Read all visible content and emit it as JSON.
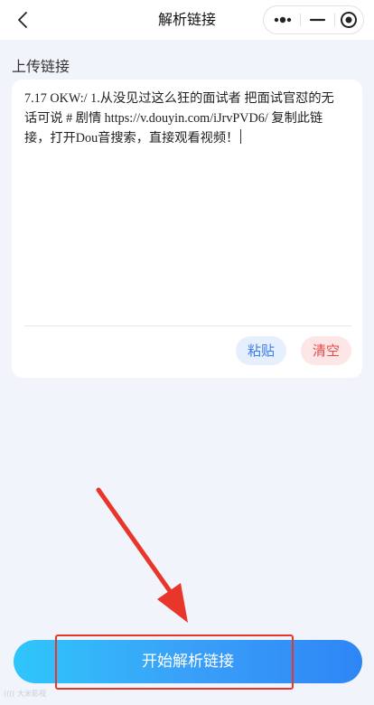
{
  "navbar": {
    "title": "解析链接",
    "back_icon": "chevron-left-icon",
    "capsule_icons": [
      "more-dots-icon",
      "minimize-icon",
      "close-target-icon"
    ]
  },
  "upload": {
    "label": "上传链接",
    "link_text": "7.17 OKW:/ 1.从没见过这么狂的面试者 把面试官怼的无话可说 # 剧情  https://v.douyin.com/iJrvPVD6/ 复制此链接，打开Dou音搜索，直接观看视频！",
    "paste_label": "粘贴",
    "clear_label": "清空"
  },
  "actions": {
    "start_label": "开始解析链接"
  },
  "colors": {
    "accent": "#3aa0f8",
    "paste_text": "#3c7ce6",
    "clear_text": "#e74848",
    "annotation": "#e8362b"
  },
  "watermark": "(((( 大米影视"
}
